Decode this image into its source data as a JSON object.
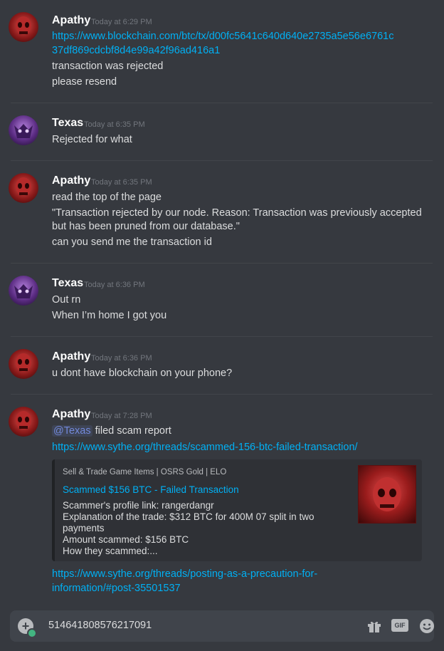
{
  "messages": [
    {
      "author": "Apathy",
      "timestamp": "Today at 6:29 PM",
      "lines": [
        "https://www.blockchain.com/btc/tx/d00fc5641c640d640e2735a5e56e6761c",
        "37df869cdcbf8d4e99a42f96ad416a1",
        "transaction was rejected",
        "please resend"
      ]
    },
    {
      "author": "Texas",
      "timestamp": "Today at 6:35 PM",
      "lines": [
        "Rejected for what"
      ]
    },
    {
      "author": "Apathy",
      "timestamp": "Today at 6:35 PM",
      "lines": [
        "read the top of the page",
        "\"Transaction rejected by our node. Reason: Transaction was previously accepted",
        "but has been pruned from our database.\"",
        "can you send me the transaction id"
      ]
    },
    {
      "author": "Texas",
      "timestamp": "Today at 6:36 PM",
      "lines": [
        "Out rn",
        "When I’m home I got you"
      ]
    },
    {
      "author": "Apathy",
      "timestamp": "Today at 6:36 PM",
      "lines": [
        "u dont have blockchain on your phone?"
      ]
    },
    {
      "author": "Apathy",
      "timestamp": "Today at 7:28 PM",
      "mention": "@Texas",
      "mention_rest": " filed scam report",
      "link1": "https://www.sythe.org/threads/scammed-156-btc-failed-transaction/",
      "embed": {
        "provider": "Sell & Trade Game Items | OSRS Gold | ELO",
        "title": "Scammed $156 BTC - Failed Transaction",
        "description": [
          "Scammer's profile link: rangerdangr",
          "Explanation of the trade: $312 BTC for 400M 07 split in two",
          "payments",
          "Amount scammed: $156 BTC",
          "How they scammed:..."
        ]
      },
      "link2": [
        "https://www.sythe.org/threads/posting-as-a-precaution-for-",
        "information/#post-35501537"
      ]
    }
  ],
  "input": {
    "value": "514641808576217091",
    "gif_label": "GIF"
  },
  "icons": [
    "add-attachment-icon",
    "gift-icon",
    "gif-icon",
    "emoji-icon"
  ],
  "colors": {
    "link": "#00b0f4",
    "background": "#36393f",
    "input": "#40444b",
    "mention": "#7289da"
  }
}
